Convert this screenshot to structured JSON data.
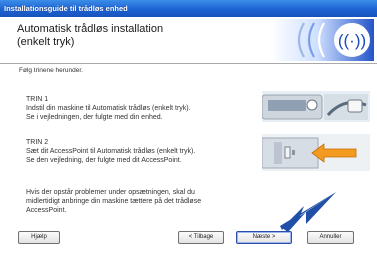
{
  "window": {
    "title": "Installationsguide til trådløs enhed"
  },
  "header": {
    "title_line1": "Automatisk trådløs installation",
    "title_line2": "(enkelt tryk)",
    "logo_icon": "wireless-signal-icon"
  },
  "intro": "Følg trinene herunder.",
  "steps": [
    {
      "title": "TRIN 1",
      "line1": "Indstil din maskine til Automatisk trådløs (enkelt tryk).",
      "line2": "Se i vejledningen, der fulgte med din enhed."
    },
    {
      "title": "TRIN 2",
      "line1": "Sæt dit AccessPoint til Automatisk trådløs (enkelt tryk).",
      "line2": "Se den vejledning, der fulgte med dit AccessPoint."
    }
  ],
  "note": {
    "line1": "Hvis der opstår problemer under opsætningen, skal du",
    "line2": "midlertidigt anbringe din maskine tættere på det trådløse",
    "line3": "AccessPoint."
  },
  "buttons": {
    "help": "Hjælp",
    "back": "< Tilbage",
    "next": "Næste >",
    "cancel": "Annuller"
  },
  "colors": {
    "titlebar": "#1d63d3",
    "header_graphic": "#2456c7",
    "arrow": "#1f4fa6",
    "arrow_orange": "#f39a21"
  }
}
